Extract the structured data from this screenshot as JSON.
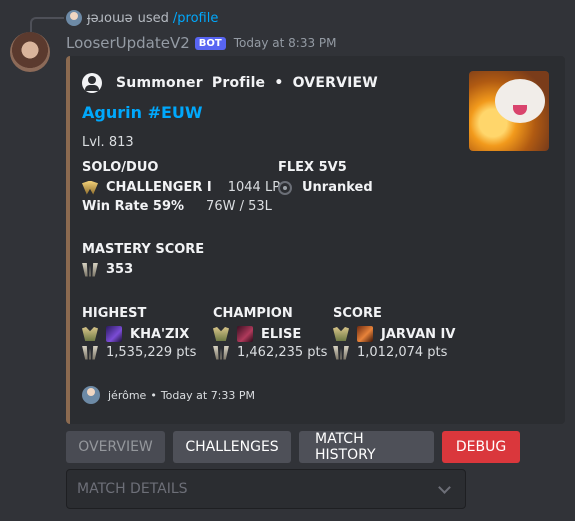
{
  "reply": {
    "username": "ɟǝɹoɯǝ",
    "action": "used",
    "command": "/profile"
  },
  "message": {
    "author": "LooserUpdateV2",
    "bot_tag": "BOT",
    "timestamp": "Today at 8:33 PM"
  },
  "embed": {
    "color": "#8b6a50",
    "author_left": "Summoner",
    "author_mid": "Profile",
    "author_sep": "•",
    "author_right": "OVERVIEW",
    "title_name": "Agurin",
    "title_tag": "#EUW",
    "level": "Lvl. 813",
    "solo": {
      "name": "SOLO/DUO",
      "tier": "CHALLENGER I",
      "lp": "1044 LP",
      "winrate": "Win Rate 59%",
      "record": "76W / 53L"
    },
    "flex": {
      "name": "FLEX 5V5",
      "tier": "Unranked"
    },
    "mastery": {
      "name": "MASTERY SCORE",
      "value": "353"
    },
    "highest": {
      "name": "HIGHEST",
      "champion": "KHA'ZIX",
      "points": "1,535,229 pts"
    },
    "champion": {
      "name": "CHAMPION",
      "champion": "ELISE",
      "points": "1,462,235 pts"
    },
    "score": {
      "name": "SCORE",
      "champion": "JARVAN IV",
      "points": "1,012,074 pts"
    },
    "footer": {
      "user": "jérôme",
      "sep": "•",
      "time": "Today at 7:33 PM"
    }
  },
  "buttons": {
    "overview": "OVERVIEW",
    "challenges": "CHALLENGES",
    "match_history": "MATCH HISTORY",
    "debug": "DEBUG"
  },
  "select": {
    "placeholder": "MATCH DETAILS"
  },
  "icons": [
    "user-icon",
    "challenger-icon",
    "unranked-icon",
    "mastery-icon",
    "crest-icon",
    "champion-portrait",
    "chevron-down-icon"
  ]
}
